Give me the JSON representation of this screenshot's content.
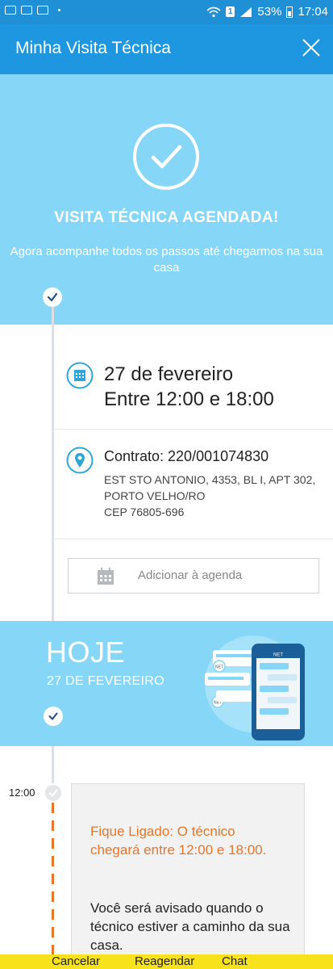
{
  "status_bar": {
    "battery": "53%",
    "time": "17:04",
    "sim": "1"
  },
  "app_bar": {
    "title": "Minha Visita Técnica"
  },
  "hero": {
    "title": "VISITA TÉCNICA AGENDADA!",
    "subtitle": "Agora acompanhe todos os passos até chegarmos na sua casa"
  },
  "schedule": {
    "date": "27 de fevereiro",
    "window": "Entre 12:00 e 18:00"
  },
  "contract": {
    "label": "Contrato: 220/001074830",
    "address_line1": "EST STO ANTONIO, 4353, BL I, APT 302,",
    "address_line2": "PORTO VELHO/RO",
    "cep": "CEP 76805-696"
  },
  "agenda_button": {
    "label": "Adicionar à agenda"
  },
  "today": {
    "title": "HOJE",
    "date": "27 DE FEVEREIRO",
    "brand": "NET"
  },
  "timeline_entry": {
    "time": "12:00",
    "warning": "Fique Ligado: O técnico chegará entre 12:00 e 18:00.",
    "info": "Você será avisado quando o técnico estiver a caminho da sua casa."
  },
  "bottom_bar": {
    "cancel": "Cancelar",
    "reschedule": "Reagendar",
    "chat": "Chat"
  },
  "colors": {
    "primary": "#1f97e0",
    "light_blue": "#85d6f7",
    "accent_orange": "#e5762a",
    "bottom_yellow": "#f7e21b"
  }
}
